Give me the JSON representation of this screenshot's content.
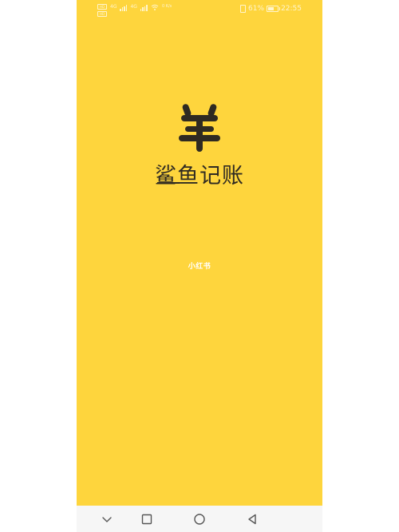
{
  "status_bar": {
    "sim1_tag": "HD",
    "sim2_tag": "HD",
    "sim1_network": "4G",
    "sim2_network": "4G",
    "wifi_label": "WiFi",
    "speed": "0 K/s",
    "battery_percent": "61%",
    "battery_level": 0.61,
    "time": "22:55"
  },
  "app": {
    "logo_icon": "yen-sheep-icon",
    "name": "鲨鱼记账",
    "brand_color": "#fed53d",
    "text_color": "#2f2a22"
  },
  "watermark": "小红书",
  "nav_bar": {
    "icons": [
      "chevron-down-icon",
      "recents-square-icon",
      "home-circle-icon",
      "back-triangle-icon"
    ]
  }
}
